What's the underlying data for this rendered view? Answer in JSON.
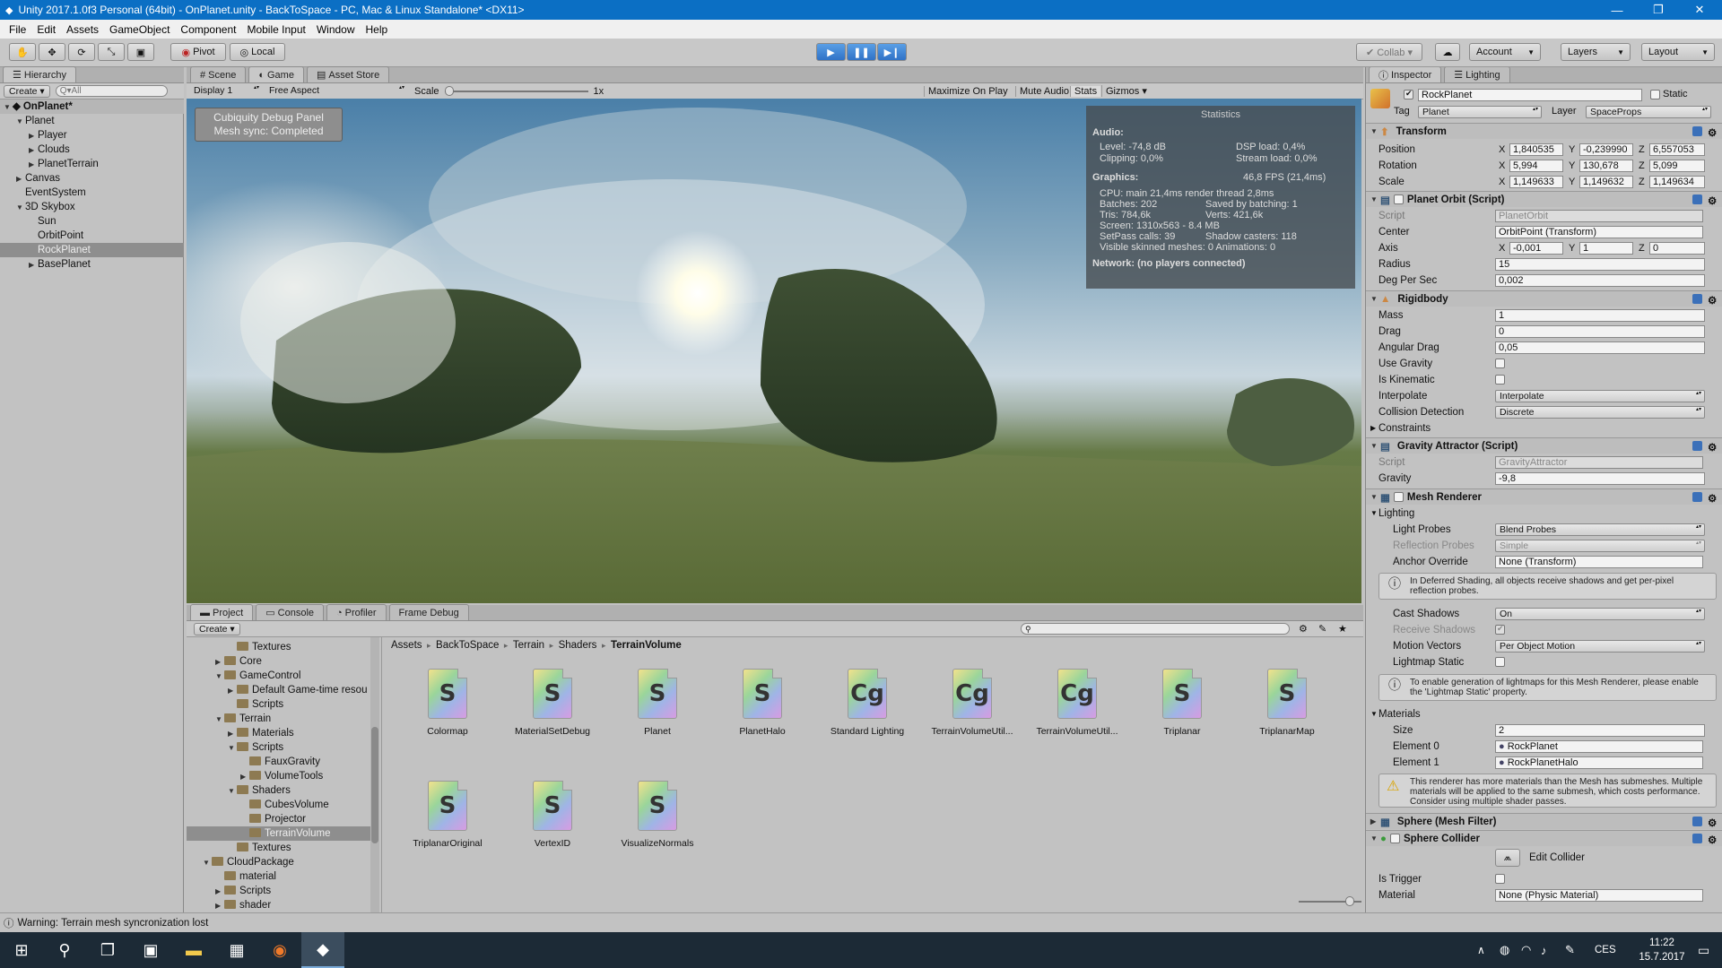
{
  "window": {
    "title": "Unity 2017.1.0f3 Personal (64bit) - OnPlanet.unity - BackToSpace - PC, Mac & Linux Standalone* <DX11>",
    "controls": [
      "—",
      "❐",
      "✕"
    ]
  },
  "menu": [
    "File",
    "Edit",
    "Assets",
    "GameObject",
    "Component",
    "Mobile Input",
    "Window",
    "Help"
  ],
  "toolbar": {
    "pivot": "Pivot",
    "local": "Local",
    "collab": "Collab ▾",
    "account": "Account",
    "layers": "Layers",
    "layout": "Layout"
  },
  "hierarchy": {
    "tab": "Hierarchy",
    "create": "Create ▾",
    "search_placeholder": "Q▾All",
    "scene": "OnPlanet*",
    "items": [
      {
        "label": "Planet",
        "indent": 1,
        "arrow": "▼"
      },
      {
        "label": "Player",
        "indent": 2,
        "arrow": "▶"
      },
      {
        "label": "Clouds",
        "indent": 2,
        "arrow": "▶"
      },
      {
        "label": "PlanetTerrain",
        "indent": 2,
        "arrow": "▶"
      },
      {
        "label": "Canvas",
        "indent": 1,
        "arrow": "▶"
      },
      {
        "label": "EventSystem",
        "indent": 1,
        "arrow": ""
      },
      {
        "label": "3D Skybox",
        "indent": 1,
        "arrow": "▼"
      },
      {
        "label": "Sun",
        "indent": 2,
        "arrow": ""
      },
      {
        "label": "OrbitPoint",
        "indent": 2,
        "arrow": ""
      },
      {
        "label": "RockPlanet",
        "indent": 2,
        "arrow": "",
        "selected": true
      },
      {
        "label": "BasePlanet",
        "indent": 2,
        "arrow": "▶"
      }
    ]
  },
  "game_tabs": {
    "scene": "Scene",
    "game": "Game",
    "asset_store": "Asset Store",
    "display": "Display 1",
    "aspect": "Free Aspect",
    "scale_label": "Scale",
    "scale_value": "1x",
    "maximize": "Maximize On Play",
    "mute": "Mute Audio",
    "stats": "Stats",
    "gizmos": "Gizmos ▾"
  },
  "debug_panel": {
    "line1": "Cubiquity Debug Panel",
    "line2": "Mesh sync: Completed"
  },
  "statistics": {
    "title": "Statistics",
    "audio_h": "Audio:",
    "level": "Level: -74,8 dB",
    "dsp": "DSP load: 0,4%",
    "clipping": "Clipping: 0,0%",
    "stream": "Stream load: 0,0%",
    "graphics_h": "Graphics:",
    "fps": "46,8 FPS (21,4ms)",
    "cpu": "CPU: main 21,4ms  render thread 2,8ms",
    "batches": "Batches: 202",
    "saved": "Saved by batching: 1",
    "tris": "Tris: 784,6k",
    "verts": "Verts: 421,6k",
    "screen": "Screen: 1310x563 - 8.4 MB",
    "setpass": "SetPass calls: 39",
    "shadow": "Shadow casters: 118",
    "visible": "Visible skinned meshes: 0  Animations: 0",
    "network": "Network: (no players connected)"
  },
  "project": {
    "tabs": [
      "Project",
      "Console",
      "Profiler",
      "Frame Debug"
    ],
    "create": "Create ▾",
    "tree": [
      {
        "label": "Textures",
        "indent": 3,
        "arrow": ""
      },
      {
        "label": "Core",
        "indent": 2,
        "arrow": "▶"
      },
      {
        "label": "GameControl",
        "indent": 2,
        "arrow": "▼"
      },
      {
        "label": "Default Game-time resou",
        "indent": 3,
        "arrow": "▶"
      },
      {
        "label": "Scripts",
        "indent": 3,
        "arrow": ""
      },
      {
        "label": "Terrain",
        "indent": 2,
        "arrow": "▼"
      },
      {
        "label": "Materials",
        "indent": 3,
        "arrow": "▶"
      },
      {
        "label": "Scripts",
        "indent": 3,
        "arrow": "▼"
      },
      {
        "label": "FauxGravity",
        "indent": 4,
        "arrow": ""
      },
      {
        "label": "VolumeTools",
        "indent": 4,
        "arrow": "▶"
      },
      {
        "label": "Shaders",
        "indent": 3,
        "arrow": "▼"
      },
      {
        "label": "CubesVolume",
        "indent": 4,
        "arrow": ""
      },
      {
        "label": "Projector",
        "indent": 4,
        "arrow": ""
      },
      {
        "label": "TerrainVolume",
        "indent": 4,
        "arrow": "",
        "selected": true
      },
      {
        "label": "Textures",
        "indent": 3,
        "arrow": ""
      },
      {
        "label": "CloudPackage",
        "indent": 1,
        "arrow": "▼"
      },
      {
        "label": "material",
        "indent": 2,
        "arrow": ""
      },
      {
        "label": "Scripts",
        "indent": 2,
        "arrow": "▶"
      },
      {
        "label": "shader",
        "indent": 2,
        "arrow": "▶"
      }
    ],
    "breadcrumb": [
      "Assets",
      "BackToSpace",
      "Terrain",
      "Shaders",
      "TerrainVolume"
    ],
    "assets": [
      {
        "label": "Colormap",
        "glyph": "S"
      },
      {
        "label": "MaterialSetDebug",
        "glyph": "S"
      },
      {
        "label": "Planet",
        "glyph": "S"
      },
      {
        "label": "PlanetHalo",
        "glyph": "S"
      },
      {
        "label": "Standard Lighting",
        "glyph": "Cg"
      },
      {
        "label": "TerrainVolumeUtil...",
        "glyph": "Cg"
      },
      {
        "label": "TerrainVolumeUtil...",
        "glyph": "Cg"
      },
      {
        "label": "Triplanar",
        "glyph": "S"
      },
      {
        "label": "TriplanarMap",
        "glyph": "S"
      },
      {
        "label": "TriplanarOriginal",
        "glyph": "S"
      },
      {
        "label": "VertexID",
        "glyph": "S"
      },
      {
        "label": "VisualizeNormals",
        "glyph": "S"
      }
    ]
  },
  "inspector": {
    "tab": "Inspector",
    "tab2": "Lighting",
    "object_name": "RockPlanet",
    "static": "Static",
    "tag_label": "Tag",
    "tag": "Planet",
    "layer_label": "Layer",
    "layer": "SpaceProps",
    "transform": {
      "title": "Transform",
      "position_label": "Position",
      "pos_x": "1,840535",
      "pos_y": "-0,239990",
      "pos_z": "6,557053",
      "rotation_label": "Rotation",
      "rot_x": "5,994",
      "rot_y": "130,678",
      "rot_z": "5,099",
      "scale_label": "Scale",
      "sc_x": "1,149633",
      "sc_y": "1,149632",
      "sc_z": "1,149634"
    },
    "orbit": {
      "title": "Planet Orbit (Script)",
      "script_label": "Script",
      "script": "PlanetOrbit",
      "center_label": "Center",
      "center": "OrbitPoint (Transform)",
      "axis_label": "Axis",
      "ax_x": "-0,001",
      "ax_y": "1",
      "ax_z": "0",
      "radius_label": "Radius",
      "radius": "15",
      "deg_label": "Deg Per Sec",
      "deg": "0,002"
    },
    "rigidbody": {
      "title": "Rigidbody",
      "mass_label": "Mass",
      "mass": "1",
      "drag_label": "Drag",
      "drag": "0",
      "adrag_label": "Angular Drag",
      "adrag": "0,05",
      "gravity_label": "Use Gravity",
      "kinematic_label": "Is Kinematic",
      "interp_label": "Interpolate",
      "interp": "Interpolate",
      "coll_label": "Collision Detection",
      "coll": "Discrete",
      "constraints": "Constraints"
    },
    "gravity": {
      "title": "Gravity Attractor (Script)",
      "script_label": "Script",
      "script": "GravityAttractor",
      "gravity_label": "Gravity",
      "gravity": "-9,8"
    },
    "mesh_renderer": {
      "title": "Mesh Renderer",
      "lighting": "Lighting",
      "probes_label": "Light Probes",
      "probes": "Blend Probes",
      "refl_label": "Reflection Probes",
      "refl": "Simple",
      "anchor_label": "Anchor Override",
      "anchor": "None (Transform)",
      "help1": "In Deferred Shading, all objects receive shadows and get per-pixel reflection probes.",
      "cast_label": "Cast Shadows",
      "cast": "On",
      "receive_label": "Receive Shadows",
      "motion_label": "Motion Vectors",
      "motion": "Per Object Motion",
      "lmstatic_label": "Lightmap Static",
      "help2": "To enable generation of lightmaps for this Mesh Renderer, please enable the 'Lightmap Static' property.",
      "materials": "Materials",
      "size_label": "Size",
      "size": "2",
      "el0_label": "Element 0",
      "el0": "RockPlanet",
      "el1_label": "Element 1",
      "el1": "RockPlanetHalo",
      "warn": "This renderer has more materials than the Mesh has submeshes. Multiple materials will be applied to the same submesh, which costs performance. Consider using multiple shader passes."
    },
    "mesh_filter": "Sphere (Mesh Filter)",
    "sphere_collider": {
      "title": "Sphere Collider",
      "edit": "Edit Collider",
      "trigger_label": "Is Trigger",
      "material_label": "Material",
      "material": "None (Physic Material)"
    }
  },
  "status": "Warning: Terrain mesh syncronization lost",
  "taskbar": {
    "time": "11:22",
    "date": "15.7.2017",
    "lang": "CES"
  },
  "colors": {
    "titlebar": "#0b6fc4",
    "play_active": "#3d86d9",
    "taskbar": "#1c2a36"
  }
}
